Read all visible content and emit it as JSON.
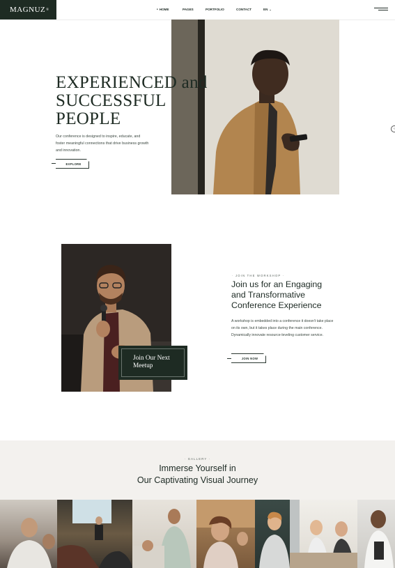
{
  "header": {
    "logo": "MAGNUZ",
    "logo_mark": "®",
    "nav": [
      {
        "label": "HOME",
        "active": true
      },
      {
        "label": "PAGES",
        "active": false
      },
      {
        "label": "PORTFOLIO",
        "active": false
      },
      {
        "label": "CONTACT",
        "active": false
      },
      {
        "label": "EN",
        "active": false
      }
    ],
    "menu_icon": "hamburger-icon"
  },
  "hero": {
    "title_line1": "EXPERIENCED and",
    "title_line2": "SUCCESSFUL",
    "title_line3": "PEOPLE",
    "description": "Our conference is designed to inspire, educate, and foster meaningful connections that drive business growth and innovation.",
    "button": "EXPLORE"
  },
  "workshop": {
    "eyebrow": "JOIN THE WORKSHOP",
    "title": "Join us for an Engaging and Transformative Conference Experience",
    "description": "A workshop is embedded into a conference it doesn't take place on its own, but it takes place during the main conference. Dynamically innovate resource-leveling customer service.",
    "button": "JOIN NOW",
    "card_line1": "Join Our Next",
    "card_line2": "Meetup"
  },
  "gallery": {
    "eyebrow": "GALLERY",
    "title_line1": "Immerse Yourself in",
    "title_line2": "Our Captivating Visual Journey"
  },
  "colors": {
    "brand_dark": "#1e2b23",
    "gallery_bg": "#f3f1ee"
  }
}
